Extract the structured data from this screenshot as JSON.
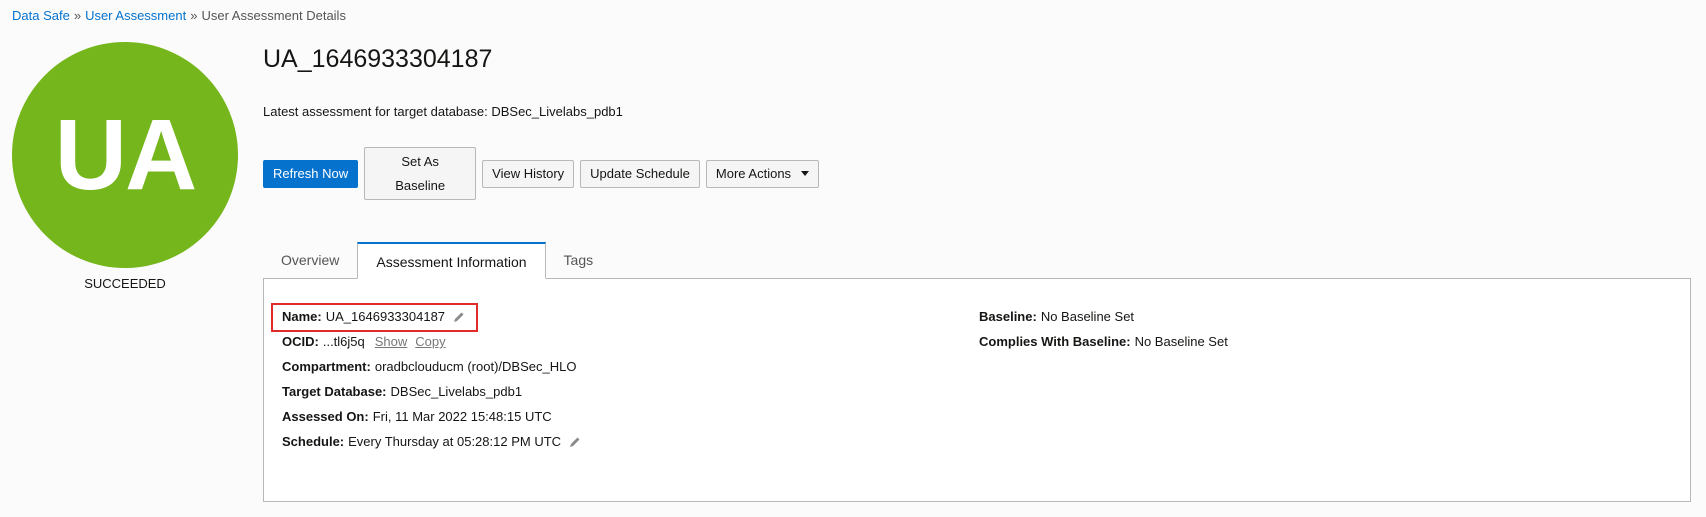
{
  "breadcrumb": {
    "items": [
      "Data Safe",
      "User Assessment"
    ],
    "current": "User Assessment Details",
    "separator": "»"
  },
  "badge": {
    "initials": "UA",
    "status": "SUCCEEDED",
    "color": "#74b61b"
  },
  "header": {
    "title": "UA_1646933304187",
    "subtitle": "Latest assessment for target database: DBSec_Livelabs_pdb1"
  },
  "actions": {
    "refresh": "Refresh Now",
    "set_baseline_line1": "Set As",
    "set_baseline_line2": "Baseline",
    "view_history": "View History",
    "update_schedule": "Update Schedule",
    "more_actions": "More Actions"
  },
  "tabs": [
    {
      "label": "Overview",
      "active": false
    },
    {
      "label": "Assessment Information",
      "active": true
    },
    {
      "label": "Tags",
      "active": false
    }
  ],
  "info": {
    "name_label": "Name:",
    "name_value": "UA_1646933304187",
    "ocid_label": "OCID:",
    "ocid_value": "...tl6j5q",
    "ocid_show": "Show",
    "ocid_copy": "Copy",
    "compartment_label": "Compartment:",
    "compartment_value": "oradbclouducm (root)/DBSec_HLO",
    "target_label": "Target Database:",
    "target_value": "DBSec_Livelabs_pdb1",
    "assessed_label": "Assessed On:",
    "assessed_value": "Fri, 11 Mar 2022 15:48:15 UTC",
    "schedule_label": "Schedule:",
    "schedule_value": "Every Thursday at 05:28:12 PM UTC",
    "baseline_label": "Baseline:",
    "baseline_value": "No Baseline Set",
    "complies_label": "Complies With Baseline:",
    "complies_value": "No Baseline Set"
  },
  "colors": {
    "primary": "#0572ce",
    "highlight": "#e02b2b"
  }
}
